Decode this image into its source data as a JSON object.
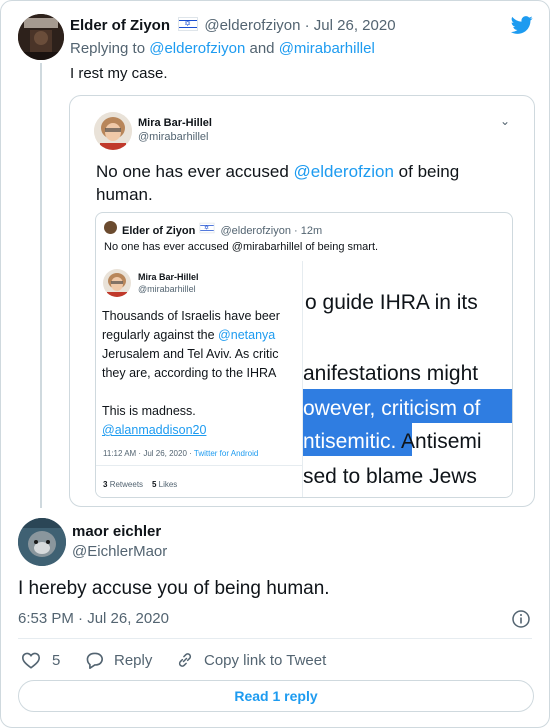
{
  "tweet": {
    "author_name": "Elder of Ziyon",
    "author_handle": "@elderofziyon",
    "date": "· Jul 26, 2020",
    "replying_prefix": "Replying to",
    "replying_handle_1": "@elderofziyon",
    "replying_and": "and",
    "replying_handle_2": "@mirabarhillel",
    "text": "I rest my case.",
    "brand_icon": "twitter-bird-icon"
  },
  "quoted": {
    "author_name": "Mira Bar-Hillel",
    "author_handle": "@mirabarhillel",
    "text_before": "No one has ever accused ",
    "text_link": "@elderofzion",
    "text_after": " of being human.",
    "inner": {
      "author_name": "Elder of Ziyon",
      "author_handle": "@elderofziyon",
      "time": "· 12m",
      "text": "No one has ever accused @mirabarhillel of being smart.",
      "screenshot": {
        "author_name": "Mira Bar-Hillel",
        "author_handle": "@mirabarhillel",
        "line1": "Thousands of Israelis have beer",
        "line2_before": "regularly against the ",
        "line2_link": "@netanya",
        "line3": "Jerusalem and Tel Aviv. As critic",
        "line4": "they are, according to the IHRA",
        "line5": "This is madness.",
        "line6_link": "@alanmaddison20",
        "meta": "11:12 AM · Jul 26, 2020 · ",
        "meta_link": "Twitter for Android",
        "retweets_count": "3",
        "retweets_label": "Retweets",
        "likes_count": "5",
        "likes_label": "Likes"
      },
      "doc_fragment": {
        "line1": "o guide IHRA in its",
        "line2": "anifestations might",
        "line3": "owever, criticism of",
        "line4a": "ntisemitic.",
        "line4b": " Antisemi",
        "line5": "sed to blame Jews"
      }
    }
  },
  "reply": {
    "author_name": "maor eichler",
    "author_handle": "@EichlerMaor",
    "text": "I hereby accuse you of being human.",
    "timestamp": "6:53 PM · Jul 26, 2020",
    "likes_count": "5",
    "reply_label": "Reply",
    "copy_link_label": "Copy link to Tweet",
    "read_replies_label": "Read 1 reply"
  },
  "colors": {
    "link_blue": "#1d9bf0",
    "highlight_blue": "#2f7de1",
    "border": "#cfd9de",
    "muted": "#536471"
  }
}
